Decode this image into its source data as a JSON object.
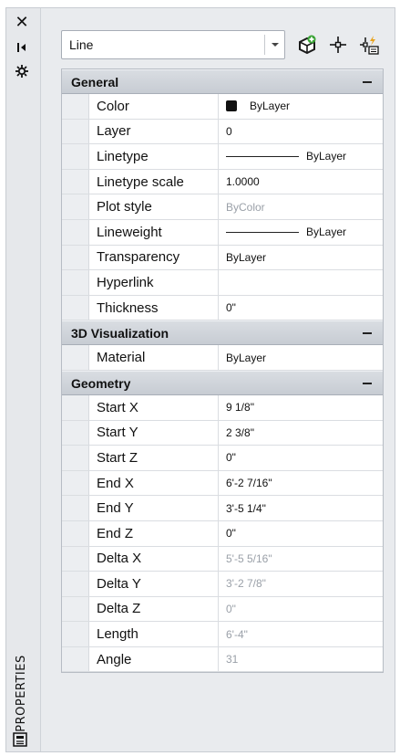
{
  "panel": {
    "title": "PROPERTIES",
    "icons": {
      "close": "close-icon",
      "autohide": "autohide-icon",
      "settings": "settings-icon",
      "bottom": "properties-panel-icon"
    }
  },
  "toolbar": {
    "selection": "Line",
    "buttons": [
      "toggle-pickadd-icon",
      "select-objects-icon",
      "quick-select-icon"
    ]
  },
  "sections": {
    "general": {
      "title": "General",
      "rows": [
        {
          "name": "Color",
          "value": "ByLayer"
        },
        {
          "name": "Layer",
          "value": "0"
        },
        {
          "name": "Linetype",
          "value": "ByLayer"
        },
        {
          "name": "Linetype scale",
          "value": "1.0000"
        },
        {
          "name": "Plot style",
          "value": "ByColor"
        },
        {
          "name": "Lineweight",
          "value": "ByLayer"
        },
        {
          "name": "Transparency",
          "value": "ByLayer"
        },
        {
          "name": "Hyperlink",
          "value": ""
        },
        {
          "name": "Thickness",
          "value": "0\""
        }
      ]
    },
    "visualization": {
      "title": "3D Visualization",
      "rows": [
        {
          "name": "Material",
          "value": "ByLayer"
        }
      ]
    },
    "geometry": {
      "title": "Geometry",
      "rows": [
        {
          "name": "Start X",
          "value": "9 1/8\""
        },
        {
          "name": "Start Y",
          "value": "2 3/8\""
        },
        {
          "name": "Start Z",
          "value": "0\""
        },
        {
          "name": "End X",
          "value": "6'-2 7/16\""
        },
        {
          "name": "End Y",
          "value": "3'-5 1/4\""
        },
        {
          "name": "End Z",
          "value": "0\""
        },
        {
          "name": "Delta X",
          "value": "5'-5 5/16\""
        },
        {
          "name": "Delta Y",
          "value": "3'-2 7/8\""
        },
        {
          "name": "Delta Z",
          "value": "0\""
        },
        {
          "name": "Length",
          "value": "6'-4\""
        },
        {
          "name": "Angle",
          "value": "31"
        }
      ]
    }
  },
  "colors": {
    "swatch": "#111111",
    "readonly_text": "#9aa0a8",
    "header_bg": "#cfd3d9"
  }
}
